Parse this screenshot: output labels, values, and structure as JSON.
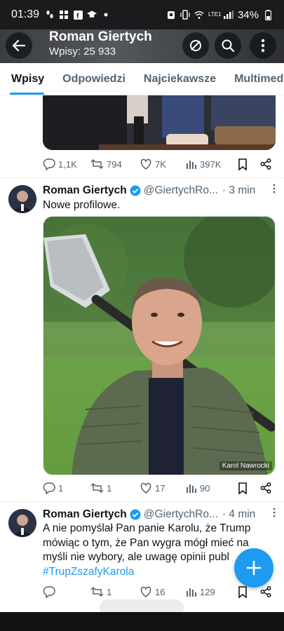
{
  "status_bar": {
    "time": "01:39",
    "battery": "34%",
    "network": "LTE1",
    "icons": [
      "footprints-icon",
      "grid-icon",
      "facebook-icon",
      "graduation-cap-icon",
      "dot-icon",
      "alarm-icon",
      "vibrate-icon",
      "wifi-icon",
      "signal-icon",
      "battery-icon"
    ]
  },
  "header": {
    "name": "Roman Giertych",
    "post_count": "Wpisy: 25 933",
    "icons": [
      "back-arrow-icon",
      "no-sync-icon",
      "search-icon",
      "more-vertical-icon"
    ]
  },
  "tabs": [
    {
      "label": "Wpisy",
      "active": true
    },
    {
      "label": "Odpowiedzi",
      "active": false
    },
    {
      "label": "Najciekawsze",
      "active": false
    },
    {
      "label": "Multimedia",
      "active": false
    }
  ],
  "tweets": [
    {
      "stats": {
        "replies": "1,1K",
        "reposts": "794",
        "likes": "7K",
        "views": "397K"
      }
    },
    {
      "display_name": "Roman Giertych",
      "handle": "@GiertychRo...",
      "time": "· 3 min",
      "text": "Nowe profilowe.",
      "photo_credit": "Karol Nawrocki",
      "stats": {
        "replies": "1",
        "reposts": "1",
        "likes": "17",
        "views": "90"
      }
    },
    {
      "display_name": "Roman Giertych",
      "handle": "@GiertychRo...",
      "time": "· 4 min",
      "text_lines": [
        "A nie pomyślał Pan panie Karolu, że Trump",
        "mówiąc o tym, że Pan wygra mógł mieć na",
        "myśli nie wybory, ale uwagę opinii publ"
      ],
      "hashtag": "#TrupZszafyKarola",
      "stats": {
        "replies": "",
        "reposts": "1",
        "likes": "16",
        "views": "129"
      }
    }
  ],
  "colors": {
    "accent": "#1d9bf0",
    "text": "#0f1419",
    "muted": "#536471"
  }
}
